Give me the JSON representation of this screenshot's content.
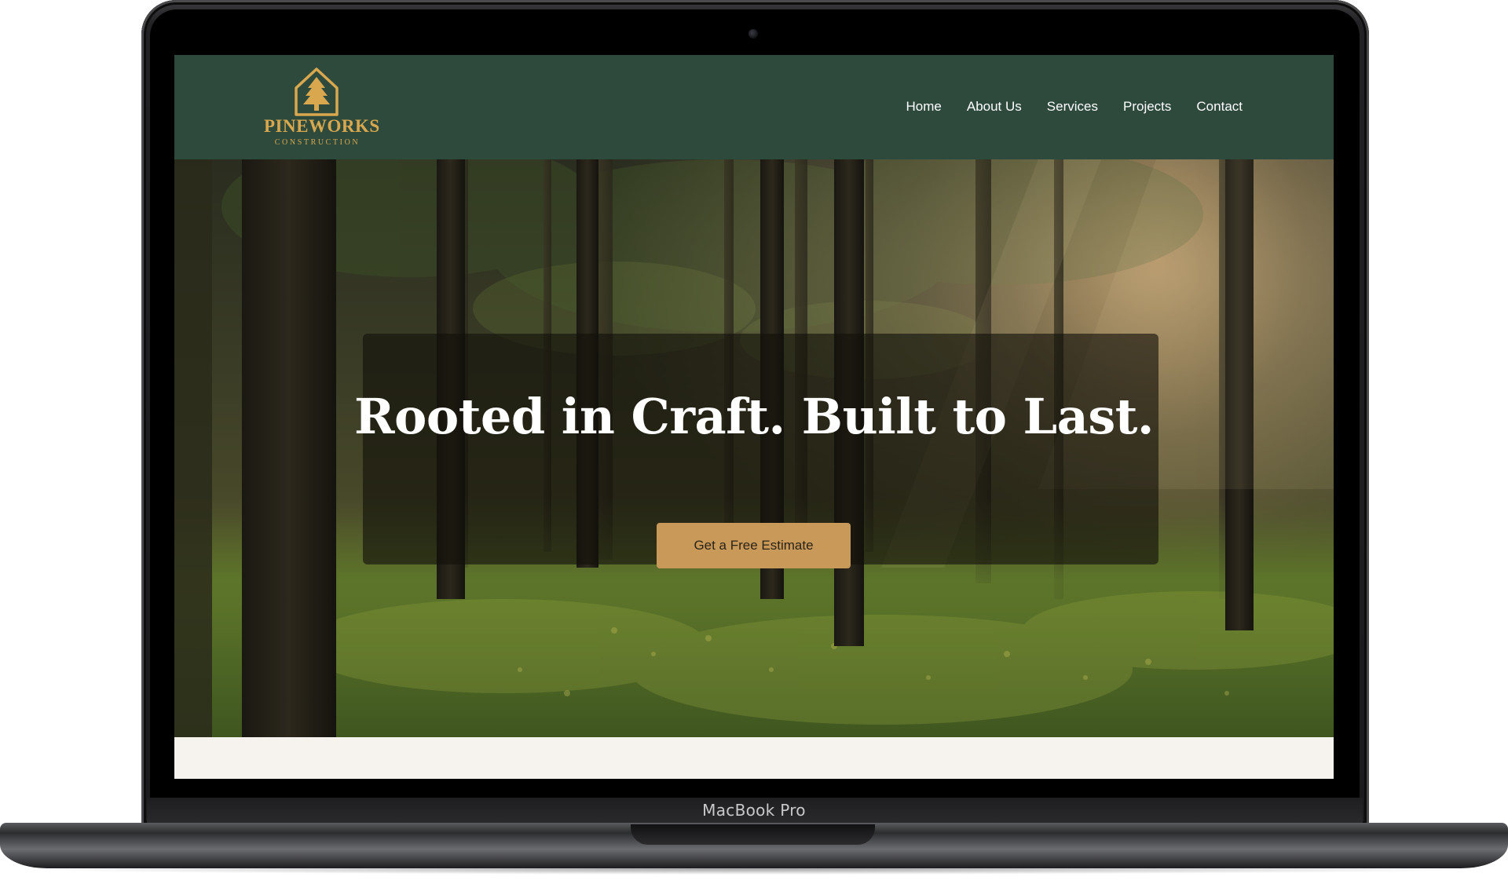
{
  "device": {
    "chin_label": "MacBook Pro"
  },
  "site": {
    "logo": {
      "name": "PINEWORKS",
      "tagline": "CONSTRUCTION"
    },
    "nav": {
      "items": [
        {
          "label": "Home"
        },
        {
          "label": "About Us"
        },
        {
          "label": "Services"
        },
        {
          "label": "Projects"
        },
        {
          "label": "Contact"
        }
      ]
    },
    "hero": {
      "title": "Rooted in Craft. Built to Last.",
      "cta_label": "Get a Free Estimate"
    }
  },
  "colors": {
    "header_bg": "#2e4a3c",
    "brand_gold": "#d9a84e",
    "cta_bg": "#c9995a",
    "page_bg": "#f6f3ee"
  },
  "icons": {
    "logo_mark": "pine-tree-house-icon",
    "camera": "camera-icon"
  }
}
